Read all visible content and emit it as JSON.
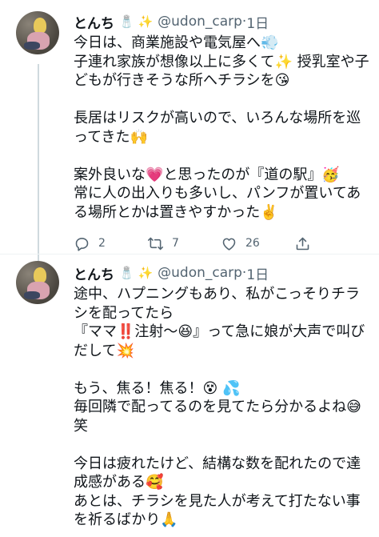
{
  "tweets": [
    {
      "author_name": "とんち",
      "author_badges": "🧂 ✨",
      "handle": "@udon_carp",
      "separator": "·",
      "time": "1日",
      "text": "今日は、商業施設や電気屋へ💨\n子連れ家族が想像以上に多くて✨ 授乳室や子どもが行きそうな所へチラシを😘\n\n長居はリスクが高いので、いろんな場所を巡ってきた🙌\n\n案外良いな💗と思ったのが『道の駅』🥳\n常に人の出入りも多いし、パンフが置いてある場所とかは置きやすかった✌️",
      "reply_count": "2",
      "retweet_count": "7",
      "like_count": "26"
    },
    {
      "author_name": "とんち",
      "author_badges": "🧂 ✨",
      "handle": "@udon_carp",
      "separator": "·",
      "time": "1日",
      "text": "途中、ハプニングもあり、私がこっそりチラシを配ってたら\n『ママ‼️注射〜😆』って急に娘が大声で叫びだして💥\n\nもう、焦る！焦る！😵 💦\n毎回隣で配ってるのを見てたら分かるよね😅笑\n\n今日は疲れたけど、結構な数を配れたので達成感がある🥰\nあとは、チラシを見た人が考えて打たない事を祈るばかり🙏"
    }
  ],
  "icons": {
    "reply": "reply-icon",
    "retweet": "retweet-icon",
    "like": "like-icon",
    "share": "share-icon"
  },
  "colors": {
    "text": "#0f1419",
    "secondary": "#536471",
    "thread_line": "#cfd9de"
  }
}
